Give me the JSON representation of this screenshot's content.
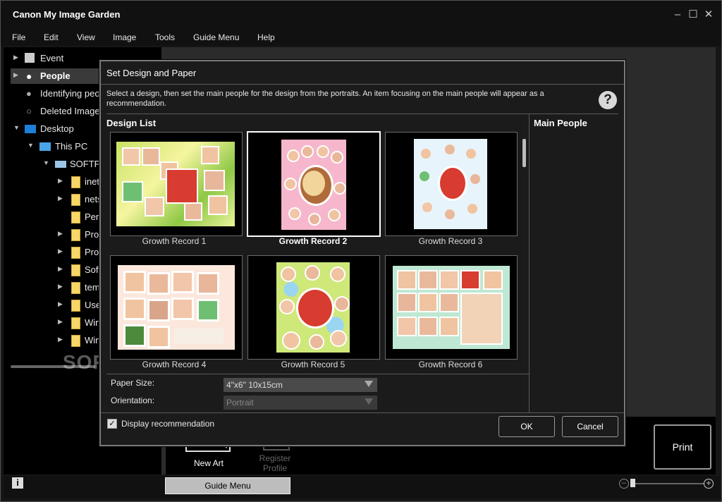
{
  "app": {
    "title": "Canon My Image Garden"
  },
  "menu": [
    "File",
    "Edit",
    "View",
    "Image",
    "Tools",
    "Guide Menu",
    "Help"
  ],
  "tree": [
    {
      "label": "Event",
      "icon": "event-icon"
    },
    {
      "label": "People",
      "icon": "person-icon"
    },
    {
      "label": "Identifying peo",
      "icon": "identifying-person-icon"
    },
    {
      "label": "Deleted Images",
      "icon": "deleted-person-icon"
    },
    {
      "label": "Desktop",
      "icon": "desktop-icon"
    },
    {
      "label": "This PC",
      "icon": "computer-icon"
    },
    {
      "label": "SOFTP",
      "icon": "network-drive-icon"
    },
    {
      "label": "inet",
      "icon": "folder-icon"
    },
    {
      "label": "nets",
      "icon": "folder-icon"
    },
    {
      "label": "Perf",
      "icon": "folder-icon"
    },
    {
      "label": "Prog",
      "icon": "folder-icon"
    },
    {
      "label": "Prog",
      "icon": "folder-icon"
    },
    {
      "label": "Soft",
      "icon": "folder-icon"
    },
    {
      "label": "temp",
      "icon": "folder-icon"
    },
    {
      "label": "Use",
      "icon": "folder-icon"
    },
    {
      "label": "Win",
      "icon": "folder-icon"
    },
    {
      "label": "Win",
      "icon": "folder-icon"
    }
  ],
  "dialog": {
    "title": "Set Design and Paper",
    "instruction": "Select a design, then set the main people for the design from the portraits. An item focusing on the main people will appear as a recommendation.",
    "design_list_label": "Design List",
    "main_people_label": "Main People",
    "designs": [
      {
        "name": "Growth Record 1",
        "selected": false
      },
      {
        "name": "Growth Record 2",
        "selected": true
      },
      {
        "name": "Growth Record 3",
        "selected": false
      },
      {
        "name": "Growth Record 4",
        "selected": false
      },
      {
        "name": "Growth Record 5",
        "selected": false
      },
      {
        "name": "Growth Record 6",
        "selected": false
      }
    ],
    "paper_size_label": "Paper Size:",
    "paper_size_value": "4\"x6\" 10x15cm",
    "orientation_label": "Orientation:",
    "orientation_value": "Portrait",
    "display_recommendation": "Display recommendation",
    "ok": "OK",
    "cancel": "Cancel"
  },
  "bottom": {
    "new_art": "New Art",
    "register_profile_line1": "Register",
    "register_profile_line2": "Profile",
    "print": "Print"
  },
  "status": {
    "guide_menu": "Guide Menu"
  },
  "watermark": "SOFTPEDIA"
}
